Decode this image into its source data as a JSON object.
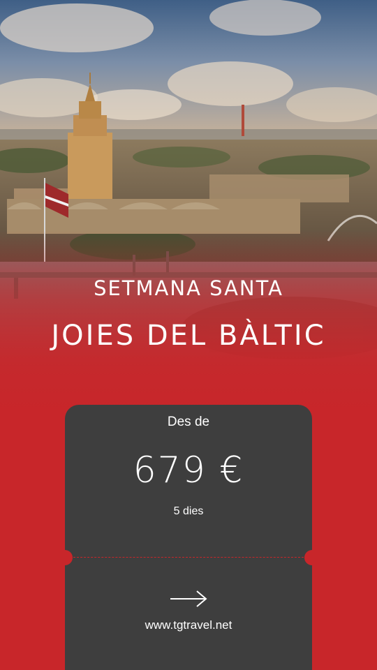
{
  "hero": {
    "subtitle": "SETMANA SANTA",
    "title": "JOIES DEL BÀLTIC"
  },
  "ticket": {
    "from_label": "Des de",
    "price": "679 €",
    "duration": "5 dies",
    "url": "www.tgtravel.net",
    "arrow_icon": "arrow-right-icon"
  },
  "colors": {
    "brand_red": "#c8262a",
    "card_gray": "#3e3e3e",
    "text": "#ffffff"
  }
}
